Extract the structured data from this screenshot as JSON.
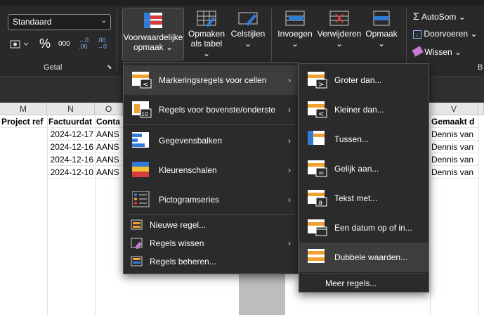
{
  "ribbon": {
    "number_format": "Standaard",
    "percent_symbol": "%",
    "thousands_symbol": "000",
    "decrease_decimals": "←0\n.00",
    "increase_decimals": ".00\n→0",
    "group_getal": "Getal",
    "conditional_formatting_line1": "Voorwaardelijke",
    "conditional_formatting_line2": "opmaak",
    "format_as_table_line1": "Opmaken",
    "format_as_table_line2": "als tabel",
    "cell_styles": "Celstijlen",
    "insert": "Invoegen",
    "delete": "Verwijderen",
    "format": "Opmaak",
    "autosum": "AutoSom",
    "fill": "Doorvoeren",
    "clear": "Wissen",
    "overflow_letter": "B"
  },
  "sheet": {
    "columns": [
      "M",
      "N",
      "O",
      "V"
    ],
    "header_row": [
      "Project ref",
      "Factuurdat",
      "Conta",
      "Gemaakt d"
    ],
    "rows": [
      {
        "date": "2024-12-17",
        "contact": "AANS",
        "creator": "Dennis van"
      },
      {
        "date": "2024-12-16",
        "contact": "AANS",
        "creator": "Dennis van"
      },
      {
        "date": "2024-12-16",
        "contact": "AANS",
        "creator": "Dennis van"
      },
      {
        "date": "2024-12-10",
        "contact": "AANS",
        "creator": "Dennis van"
      }
    ]
  },
  "menu_main": {
    "items": [
      {
        "label": "Markeringsregels voor cellen",
        "icon": "highlight-rules-icon",
        "submenu": true
      },
      {
        "label": "Regels voor bovenste/onderste",
        "icon": "top-bottom-rules-icon",
        "submenu": true
      },
      {
        "label": "Gegevensbalken",
        "icon": "data-bars-icon",
        "submenu": true
      },
      {
        "label": "Kleurenschalen",
        "icon": "color-scales-icon",
        "submenu": true
      },
      {
        "label": "Pictogramseries",
        "icon": "icon-sets-icon",
        "submenu": true
      }
    ],
    "small_items": [
      {
        "label": "Nieuwe regel...",
        "icon": "new-rule-icon",
        "submenu": false
      },
      {
        "label": "Regels wissen",
        "icon": "clear-rules-icon",
        "submenu": true
      },
      {
        "label": "Regels beheren...",
        "icon": "manage-rules-icon",
        "submenu": false
      }
    ]
  },
  "menu_sub": {
    "items": [
      {
        "label": "Groter dan...",
        "icon": "greater-than-icon"
      },
      {
        "label": "Kleiner dan...",
        "icon": "less-than-icon"
      },
      {
        "label": "Tussen...",
        "icon": "between-icon"
      },
      {
        "label": "Gelijk aan...",
        "icon": "equal-to-icon"
      },
      {
        "label": "Tekst met...",
        "icon": "text-contains-icon"
      },
      {
        "label": "Een datum op of in...",
        "icon": "date-occurring-icon"
      },
      {
        "label": "Dubbele waarden...",
        "icon": "duplicate-values-icon"
      }
    ],
    "more": "Meer regels..."
  },
  "colors": {
    "accent_blue": "#2f7bd6",
    "accent_orange": "#f0a030",
    "accent_red": "#d83b3b",
    "menu_bg": "#2b2b2b",
    "hover_bg": "#3d3d3d"
  }
}
